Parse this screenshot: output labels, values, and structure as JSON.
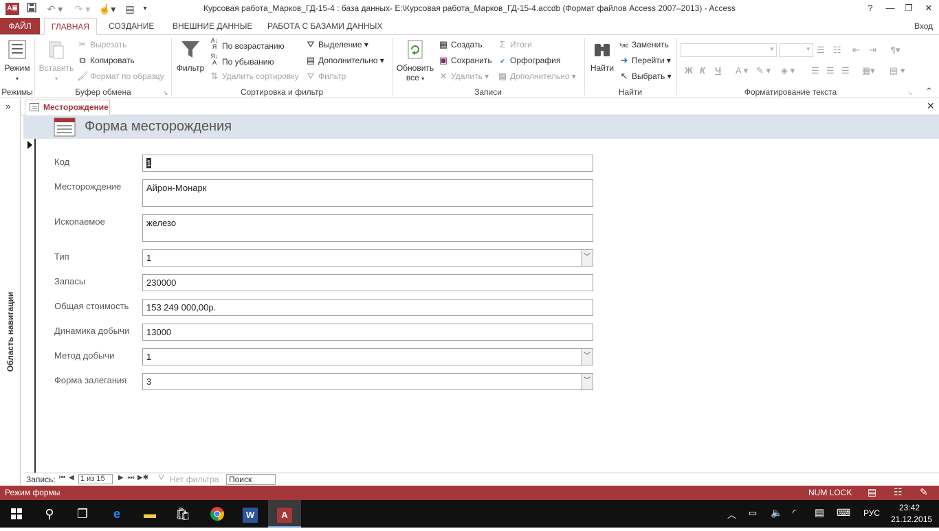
{
  "window": {
    "title": "Курсовая работа_Марков_ГД-15-4 : база данных- E:\\Курсовая работа_Марков_ГД-15-4.accdb (Формат файлов Access 2007–2013) - Access",
    "login": "Вход",
    "help": "?"
  },
  "tabs": {
    "file": "ФАЙЛ",
    "home": "ГЛАВНАЯ",
    "create": "СОЗДАНИЕ",
    "external": "ВНЕШНИЕ ДАННЫЕ",
    "dbtools": "РАБОТА С БАЗАМИ ДАННЫХ"
  },
  "ribbon": {
    "views": {
      "mode": "Режим",
      "group": "Режимы"
    },
    "clipboard": {
      "paste": "Вставить",
      "cut": "Вырезать",
      "copy": "Копировать",
      "format_painter": "Формат по образцу",
      "group": "Буфер обмена"
    },
    "sort": {
      "filter": "Фильтр",
      "asc": "По возрастанию",
      "desc": "По убыванию",
      "remove_sort": "Удалить сортировку",
      "selection": "Выделение",
      "advanced": "Дополнительно",
      "toggle_filter": "Фильтр",
      "group": "Сортировка и фильтр"
    },
    "records": {
      "refresh_line1": "Обновить",
      "refresh_line2": "все",
      "new": "Создать",
      "save": "Сохранить",
      "delete": "Удалить",
      "totals": "Итоги",
      "spelling": "Орфография",
      "more": "Дополнительно",
      "group": "Записи"
    },
    "find": {
      "find": "Найти",
      "replace": "Заменить",
      "goto": "Перейти",
      "select": "Выбрать",
      "group": "Найти"
    },
    "text": {
      "group": "Форматирование текста",
      "bold": "Ж",
      "italic": "К",
      "underline": "Ч"
    }
  },
  "nav_pane": {
    "label": "Область навигации",
    "toggle": "»"
  },
  "document": {
    "tab": "Месторождение",
    "form_title": "Форма месторождения"
  },
  "form": {
    "kod": {
      "label": "Код",
      "value": "1"
    },
    "mestorozhdenie": {
      "label": "Месторождение",
      "value": "Айрон-Монарк"
    },
    "iskopaemoe": {
      "label": "Ископаемое",
      "value": "железо"
    },
    "tip": {
      "label": "Тип",
      "value": "1"
    },
    "zapasy": {
      "label": "Запасы",
      "value": "230000"
    },
    "stoimost": {
      "label": "Общая стоимость",
      "value": "153 249 000,00р."
    },
    "dinamika": {
      "label": "Динамика добычи",
      "value": "13000"
    },
    "metod": {
      "label": "Метод добычи",
      "value": "1"
    },
    "zaleganie": {
      "label": "Форма залегания",
      "value": "3"
    }
  },
  "record_nav": {
    "label": "Запись:",
    "position": "1 из 15",
    "no_filter": "Нет фильтра",
    "search": "Поиск"
  },
  "status": {
    "mode": "Режим формы",
    "numlock": "NUM LOCK"
  },
  "taskbar": {
    "lang": "РУС",
    "time": "23:42",
    "date": "21.12.2015"
  },
  "colors": {
    "access_red": "#a4373a",
    "header_band": "#dde3ec",
    "taskbar": "#111111"
  }
}
